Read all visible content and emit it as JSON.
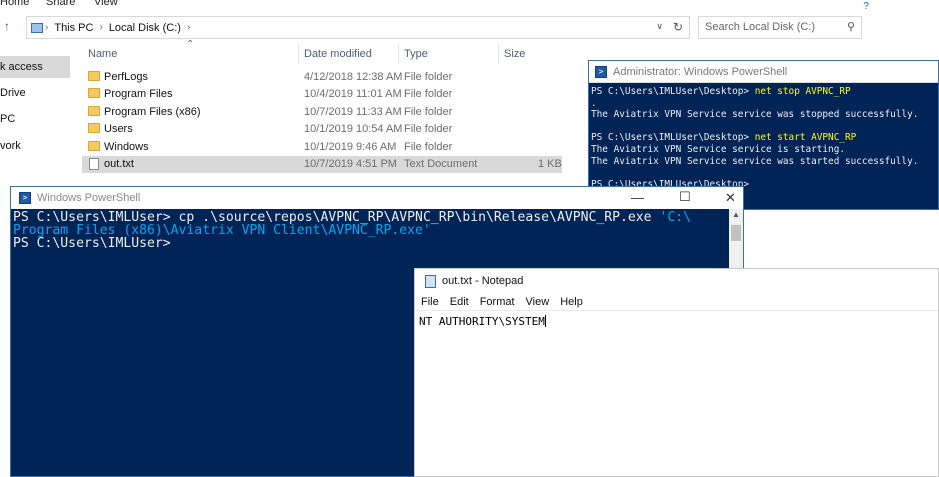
{
  "explorer": {
    "ribbon_tabs": [
      "Home",
      "Share",
      "View"
    ],
    "breadcrumb": [
      "This PC",
      "Local Disk (C:)"
    ],
    "search_placeholder": "Search Local Disk (C:)",
    "nav_items": [
      "k access",
      "Drive",
      "PC",
      "vork"
    ],
    "columns": [
      "Name",
      "Date modified",
      "Type",
      "Size"
    ],
    "files": [
      {
        "name": "PerfLogs",
        "date": "4/12/2018 12:38 AM",
        "type": "File folder",
        "size": ""
      },
      {
        "name": "Program Files",
        "date": "10/4/2019 11:01 AM",
        "type": "File folder",
        "size": ""
      },
      {
        "name": "Program Files (x86)",
        "date": "10/7/2019 11:33 AM",
        "type": "File folder",
        "size": ""
      },
      {
        "name": "Users",
        "date": "10/1/2019 10:54 AM",
        "type": "File folder",
        "size": ""
      },
      {
        "name": "Windows",
        "date": "10/1/2019 9:46 AM",
        "type": "File folder",
        "size": ""
      },
      {
        "name": "out.txt",
        "date": "10/7/2019 4:51 PM",
        "type": "Text Document",
        "size": "1 KB"
      }
    ]
  },
  "ps_admin": {
    "title": "Administrator: Windows PowerShell",
    "lines": [
      {
        "prompt": "PS C:\\Users\\IMLUser\\Desktop> ",
        "cmd": "net stop AVPNC_RP"
      },
      {
        "text": "."
      },
      {
        "text": "The Aviatrix VPN Service service was stopped successfully."
      },
      {
        "text": ""
      },
      {
        "prompt": "PS C:\\Users\\IMLUser\\Desktop> ",
        "cmd": "net start AVPNC_RP"
      },
      {
        "text": "The Aviatrix VPN Service service is starting."
      },
      {
        "text": "The Aviatrix VPN Service service was started successfully."
      },
      {
        "text": ""
      },
      {
        "prompt": "PS C:\\Users\\IMLUser\\Desktop>",
        "cmd": ""
      }
    ]
  },
  "ps_main": {
    "title": "Windows PowerShell",
    "line1_prompt": "PS C:\\Users\\IMLUser> ",
    "line1_cmd": "cp",
    "line1_arg": " .\\source\\repos\\AVPNC_RP\\AVPNC_RP\\bin\\Release\\AVPNC_RP.exe ",
    "line1_str": "'C:\\",
    "line2_str": "Program Files (x86)\\Aviatrix VPN Client\\AVPNC_RP.exe'",
    "line3_prompt": "PS C:\\Users\\IMLUser>"
  },
  "notepad": {
    "title": "out.txt - Notepad",
    "menu": [
      "File",
      "Edit",
      "Format",
      "View",
      "Help"
    ],
    "content": "NT AUTHORITY\\SYSTEM"
  },
  "icons": [
    "back-arrow-icon",
    "up-arrow-icon",
    "this-pc-icon",
    "refresh-icon",
    "search-icon",
    "folder-icon",
    "text-document-icon",
    "powershell-icon",
    "notepad-icon",
    "minimize-icon",
    "maximize-icon",
    "close-icon"
  ]
}
